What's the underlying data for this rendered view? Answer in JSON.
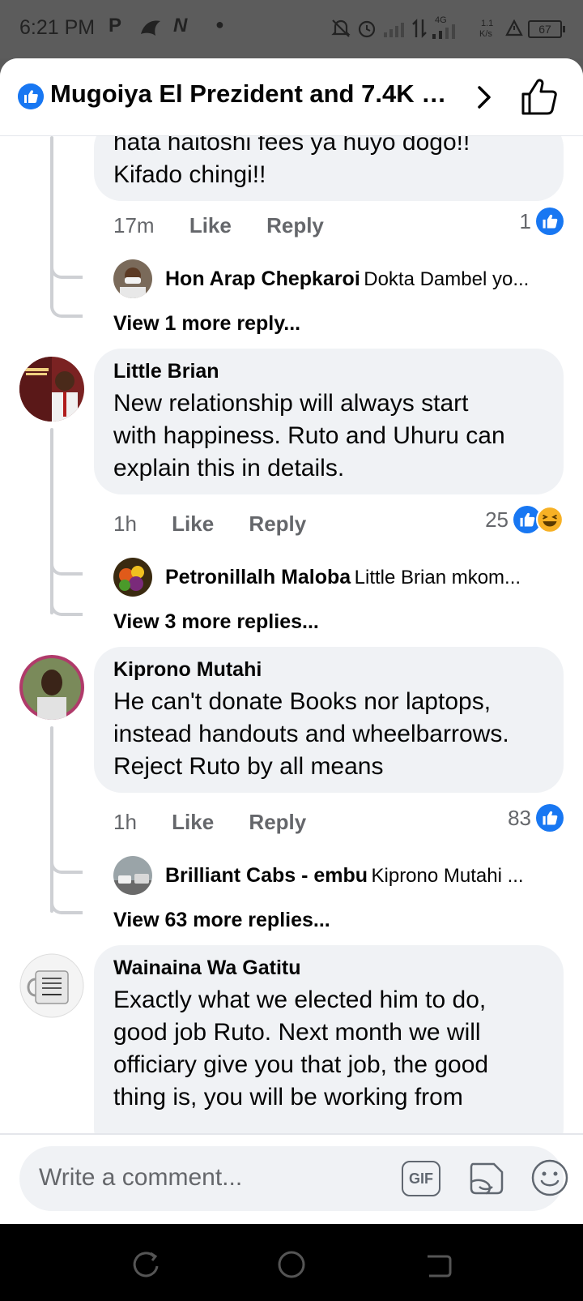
{
  "status_bar": {
    "time": "6:21 PM",
    "icons": [
      "p-app-icon",
      "ebird-icon",
      "n-app-icon",
      "dot-icon",
      "mute-icon",
      "alarm-icon",
      "signal-icon",
      "data-arrows-icon",
      "4g-signal-icon",
      "battery-icon"
    ],
    "network": "4G",
    "speed_value": "1.1",
    "speed_unit": "K/s",
    "battery": "67"
  },
  "header": {
    "title": "Mugoiya El Prezident and 7.4K ot..."
  },
  "comments": [
    {
      "id": "c0",
      "author": "",
      "text_lines": [
        "hata haitoshi fees ya huyo dogo!!",
        "Kifado chingi!!"
      ],
      "time": "17m",
      "like_label": "Like",
      "reply_label": "Reply",
      "reaction_count": "1",
      "reply_preview": {
        "name": "Hon Arap Chepkaroi",
        "text": "Dokta Dambel yo..."
      },
      "view_more": "View 1 more reply..."
    },
    {
      "id": "c1",
      "author": "Little Brian",
      "text_lines": [
        "New relationship will always start",
        "with happiness. Ruto and Uhuru can",
        "explain this in details."
      ],
      "time": "1h",
      "like_label": "Like",
      "reply_label": "Reply",
      "reaction_count": "25",
      "reply_preview": {
        "name": "Petronillalh Maloba",
        "text": "Little Brian mkom..."
      },
      "view_more": "View 3 more replies..."
    },
    {
      "id": "c2",
      "author": "Kiprono Mutahi",
      "text_lines": [
        "He can't donate Books nor laptops,",
        "instead handouts and wheelbarrows.",
        "Reject Ruto by all means"
      ],
      "time": "1h",
      "like_label": "Like",
      "reply_label": "Reply",
      "reaction_count": "83",
      "reply_preview": {
        "name": "Brilliant Cabs - embu",
        "text": "Kiprono Mutahi ..."
      },
      "view_more": "View 63 more replies..."
    },
    {
      "id": "c3",
      "author": "Wainaina Wa Gatitu",
      "text_lines": [
        "Exactly what we elected him to do,",
        "good job Ruto. Next month we will",
        "officiary give you that job, the good",
        "thing is, you will be working from"
      ]
    }
  ],
  "composer": {
    "placeholder": "Write a comment...",
    "gif_label": "GIF"
  },
  "colors": {
    "brand_blue": "#1877f2",
    "bubble_bg": "#f0f2f5",
    "secondary_text": "#65676b"
  }
}
